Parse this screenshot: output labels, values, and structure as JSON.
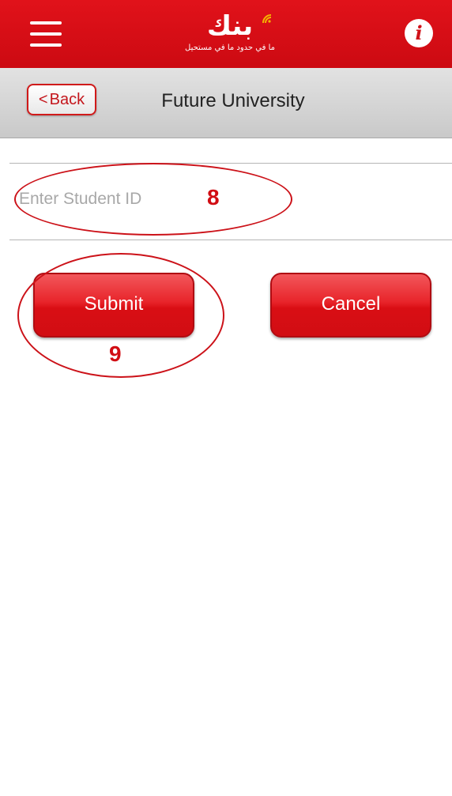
{
  "header": {
    "logo_text": "بنك",
    "logo_tagline": "ما في حدود ما في مستحيل",
    "info_glyph": "i",
    "menu_icon": "hamburger-menu-icon",
    "brand_color": "#e1121a",
    "logo_accent": "#f4b400"
  },
  "subheader": {
    "back_label": "Back",
    "back_glyph": "<",
    "title": "Future University"
  },
  "form": {
    "student_id_placeholder": "Enter Student ID",
    "student_id_value": ""
  },
  "buttons": {
    "submit_label": "Submit",
    "cancel_label": "Cancel"
  },
  "annotations": {
    "input_marker": "8",
    "submit_marker": "9",
    "color": "#cc1219"
  }
}
